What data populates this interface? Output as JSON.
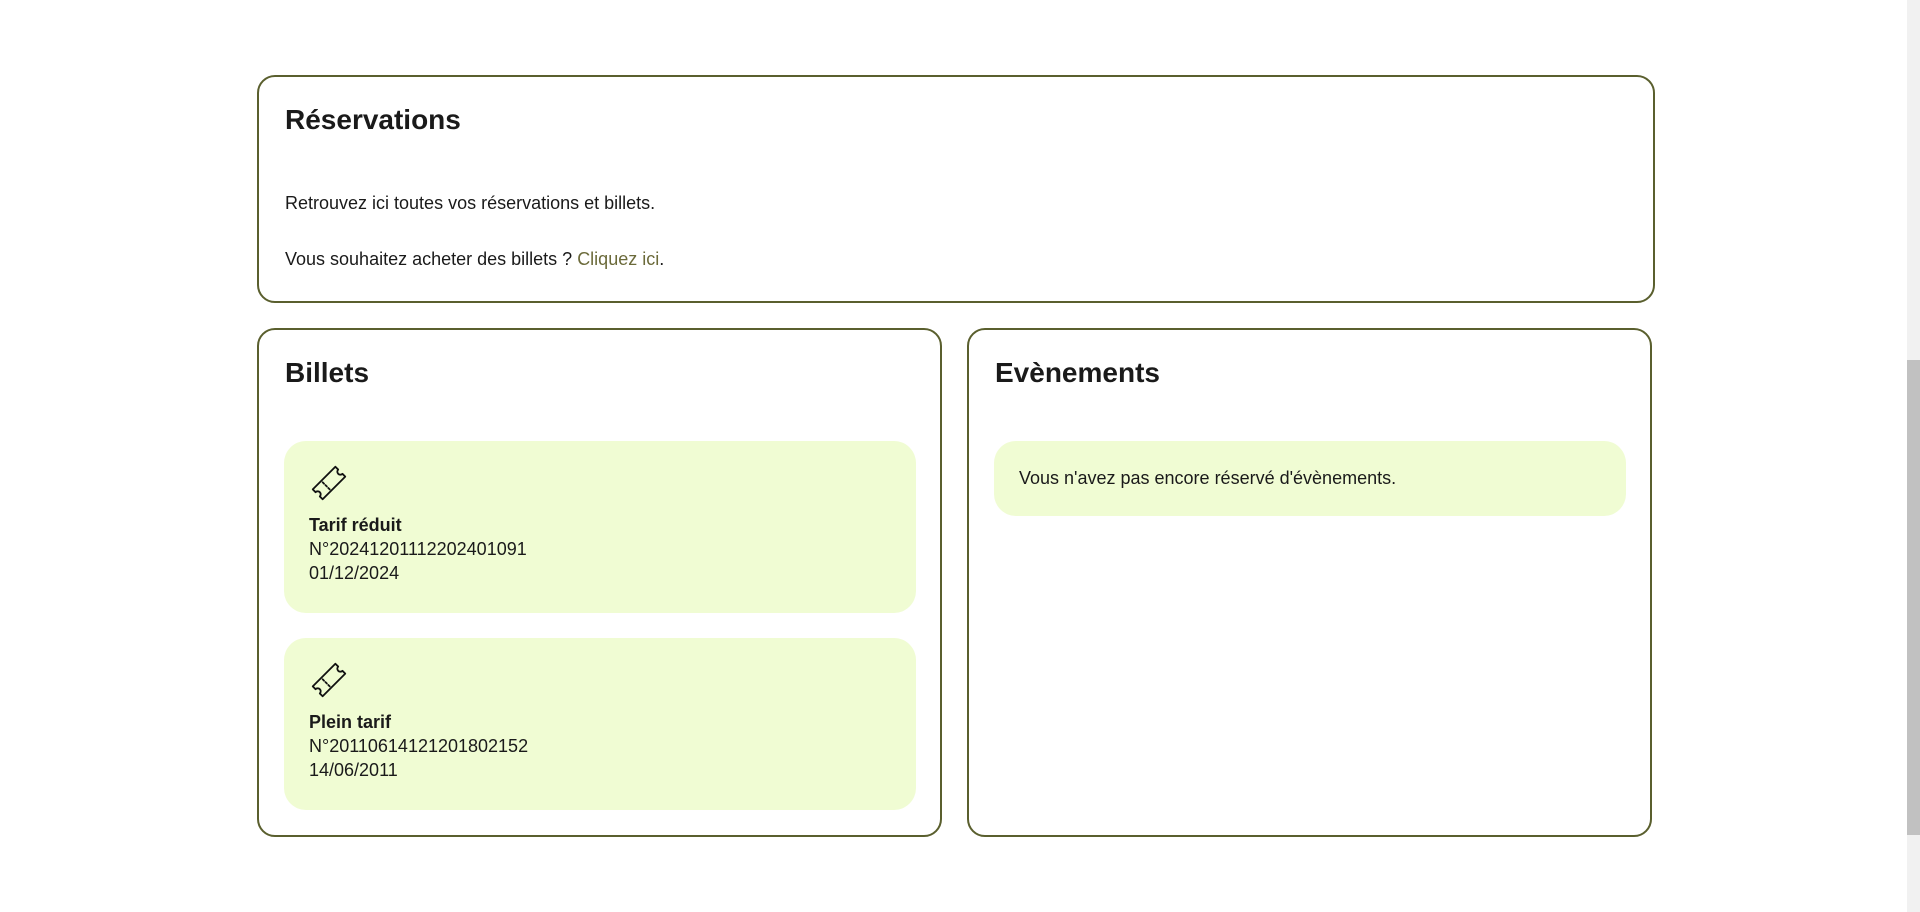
{
  "reservations": {
    "title": "Réservations",
    "intro": "Retrouvez ici toutes vos réservations et billets.",
    "buy_prompt": "Vous souhaitez acheter des billets ? ",
    "buy_link": "Cliquez ici",
    "buy_suffix": "."
  },
  "billets": {
    "title": "Billets",
    "tickets": [
      {
        "icon": "ticket-icon",
        "name": "Tarif réduit",
        "number": "N°20241201112202401091",
        "date": "01/12/2024"
      },
      {
        "icon": "ticket-icon",
        "name": "Plein tarif",
        "number": "N°20110614121201802152",
        "date": "14/06/2011"
      }
    ]
  },
  "events": {
    "title": "Evènements",
    "empty_message": "Vous n'avez pas encore réservé d'évènements."
  },
  "colors": {
    "border": "#5a5f2e",
    "ticket_bg": "#f0fcd3",
    "link": "#6b6a3a"
  }
}
